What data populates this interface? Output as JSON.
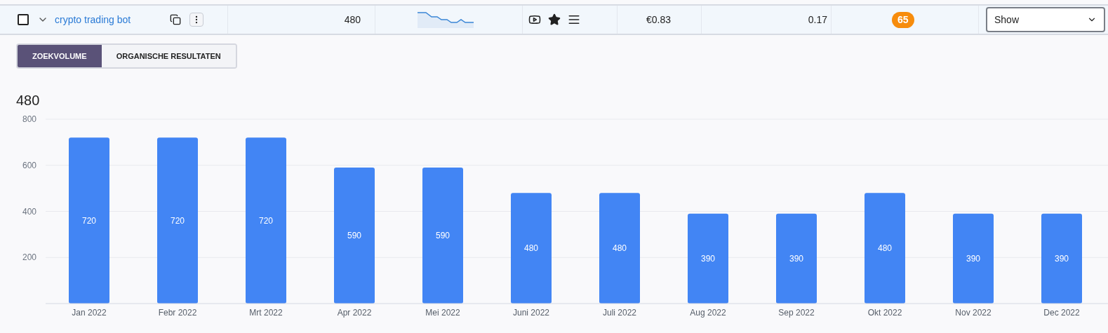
{
  "row": {
    "checked": false,
    "keyword": "crypto trading bot",
    "volume": "480",
    "cpc": "€0.83",
    "competition": "0.17",
    "score": "65",
    "select_value": "Show"
  },
  "tabs": [
    {
      "label": "ZOEKVOLUME",
      "selected": true
    },
    {
      "label": "ORGANISCHE RESULTATEN",
      "selected": false
    }
  ],
  "total": "480",
  "chart_data": {
    "type": "bar",
    "categories": [
      "Jan 2022",
      "Febr 2022",
      "Mrt 2022",
      "Apr 2022",
      "Mei 2022",
      "Juni 2022",
      "Juli 2022",
      "Aug 2022",
      "Sep 2022",
      "Okt 2022",
      "Nov 2022",
      "Dec 2022"
    ],
    "series": [
      {
        "color": "#4285f4",
        "values": [
          720,
          720,
          720,
          590,
          590,
          480,
          480,
          390,
          390,
          480,
          390,
          390
        ]
      }
    ],
    "ylim": [
      0,
      800
    ],
    "yticks": [
      {
        "value": 200,
        "label": "200"
      },
      {
        "value": 400,
        "label": "400"
      },
      {
        "value": 600,
        "label": "600"
      },
      {
        "value": 800,
        "label": "800"
      }
    ],
    "data_labels": true,
    "grid": true
  }
}
